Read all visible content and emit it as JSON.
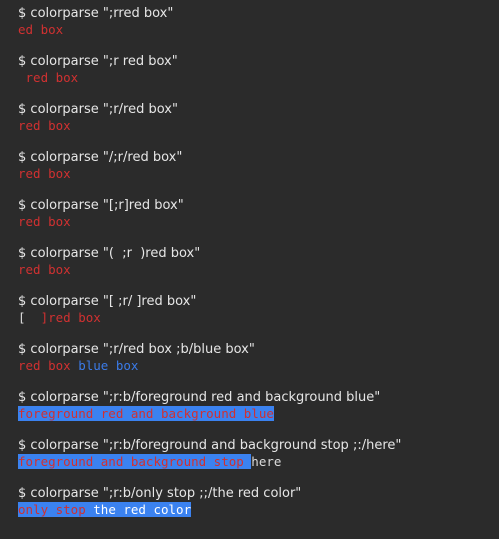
{
  "theme": {
    "background": "#2b2b2b",
    "text": "#e6e6e6",
    "red": "#d03131",
    "blue": "#3b7be8",
    "highlight_blue": "#3b82f0"
  },
  "prompt_symbol": "$",
  "program": "colorparse",
  "entries": [
    {
      "args": "\";rred box\"",
      "output": [
        {
          "text": "ed box",
          "style": "red"
        }
      ]
    },
    {
      "args": "\";r red box\"",
      "output": [
        {
          "text": " red box",
          "style": "red"
        }
      ]
    },
    {
      "args": "\";r/red box\"",
      "output": [
        {
          "text": "red box",
          "style": "red"
        }
      ]
    },
    {
      "args": "\"/;r/red box\"",
      "output": [
        {
          "text": "red box",
          "style": "red"
        }
      ]
    },
    {
      "args": "\"[;r]red box\"",
      "output": [
        {
          "text": "red box",
          "style": "red"
        }
      ]
    },
    {
      "args": "\"(  ;r  )red box\"",
      "output": [
        {
          "text": "red box",
          "style": "red"
        }
      ]
    },
    {
      "args": "\"[ ;r/ ]red box\"",
      "output": [
        {
          "text": "[  ",
          "style": "plain"
        },
        {
          "text": "]red box",
          "style": "red"
        }
      ]
    },
    {
      "args": "\";r/red box ;b/blue box\"",
      "output": [
        {
          "text": "red box ",
          "style": "red"
        },
        {
          "text": "blue box",
          "style": "blue"
        }
      ]
    },
    {
      "args": "\";r:b/foreground red and background blue\"",
      "output": [
        {
          "text": "foreground red and background blue",
          "style": "red bg-blue"
        }
      ]
    },
    {
      "args": "\";r:b/foreground and background stop ;:/here\"",
      "output": [
        {
          "text": "foreground and background stop ",
          "style": "red bg-blue"
        },
        {
          "text": "here",
          "style": "plain"
        }
      ]
    },
    {
      "args": "\";r:b/only stop ;;/the red color\"",
      "output": [
        {
          "text": "only stop ",
          "style": "red bg-blue"
        },
        {
          "text": "the red color",
          "style": "white bg-blue"
        }
      ]
    }
  ]
}
